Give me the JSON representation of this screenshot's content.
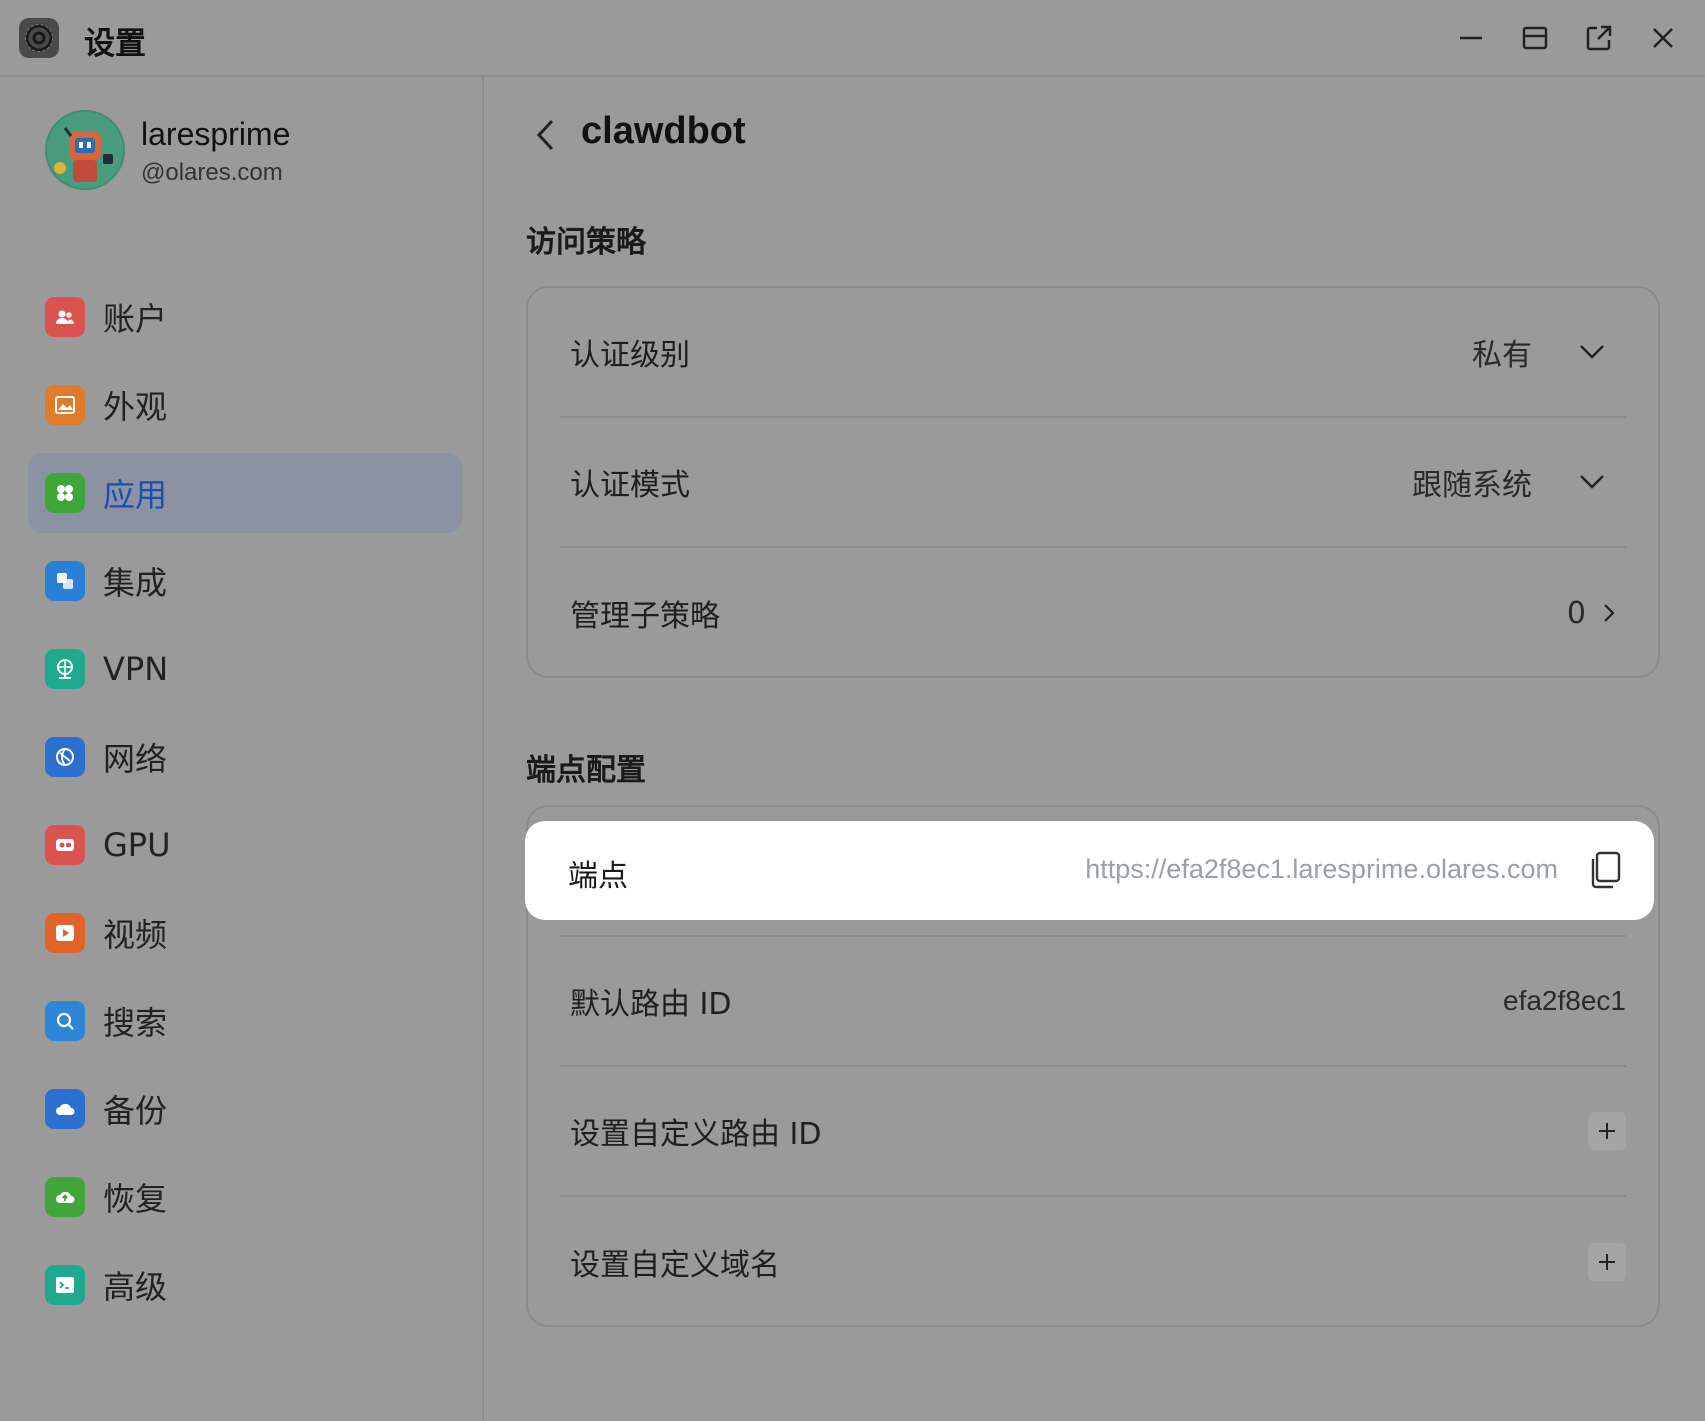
{
  "window": {
    "title": "设置",
    "controls": [
      "minimize-icon",
      "maximize-icon",
      "open-external-icon",
      "close-icon"
    ]
  },
  "user": {
    "name": "laresprime",
    "domain": "@olares.com"
  },
  "sidebar": {
    "items": [
      {
        "label": "账户",
        "icon": "accounts-icon",
        "color": "#d9534f",
        "active": false
      },
      {
        "label": "外观",
        "icon": "appearance-icon",
        "color": "#e07b2c",
        "active": false
      },
      {
        "label": "应用",
        "icon": "apps-icon",
        "color": "#3fa63a",
        "active": true
      },
      {
        "label": "集成",
        "icon": "integration-icon",
        "color": "#2b7fd6",
        "active": false
      },
      {
        "label": "VPN",
        "icon": "vpn-icon",
        "color": "#1fa98f",
        "active": false
      },
      {
        "label": "网络",
        "icon": "network-icon",
        "color": "#2b6fd0",
        "active": false
      },
      {
        "label": "GPU",
        "icon": "gpu-icon",
        "color": "#d9534f",
        "active": false
      },
      {
        "label": "视频",
        "icon": "video-icon",
        "color": "#e0632c",
        "active": false
      },
      {
        "label": "搜索",
        "icon": "search-icon",
        "color": "#2f86d6",
        "active": false
      },
      {
        "label": "备份",
        "icon": "backup-icon",
        "color": "#2b6fd0",
        "active": false
      },
      {
        "label": "恢复",
        "icon": "restore-icon",
        "color": "#3fa63a",
        "active": false
      },
      {
        "label": "高级",
        "icon": "advanced-icon",
        "color": "#1fa98f",
        "active": false
      }
    ]
  },
  "main": {
    "title": "clawdbot",
    "access_policy": {
      "heading": "访问策略",
      "rows": [
        {
          "label": "认证级别",
          "value": "私有",
          "control": "chevron-down-icon"
        },
        {
          "label": "认证模式",
          "value": "跟随系统",
          "control": "chevron-down-icon"
        },
        {
          "label": "管理子策略",
          "value": "0",
          "control": "chevron-right-icon"
        }
      ]
    },
    "endpoint_config": {
      "heading": "端点配置",
      "endpoint": {
        "label": "端点",
        "value": "https://efa2f8ec1.laresprime.olares.com"
      },
      "rows": [
        {
          "label": "默认路由 ID",
          "value": "efa2f8ec1"
        },
        {
          "label": "设置自定义路由 ID",
          "control": "plus-icon"
        },
        {
          "label": "设置自定义域名",
          "control": "plus-icon"
        }
      ]
    }
  }
}
